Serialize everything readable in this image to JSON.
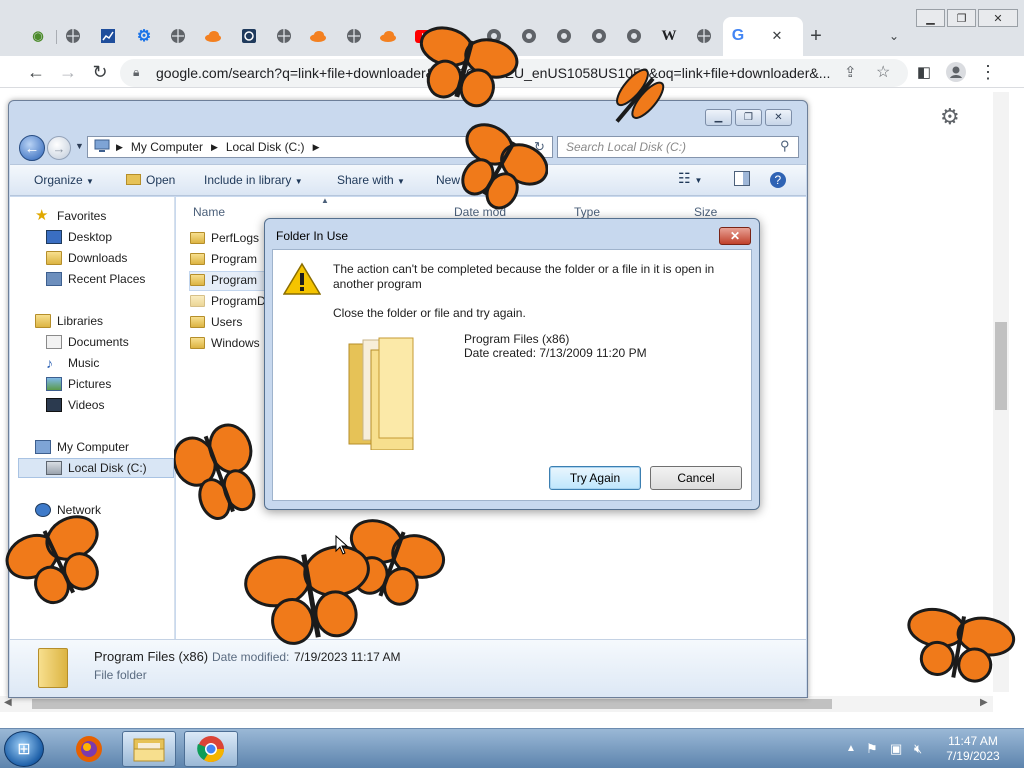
{
  "browser": {
    "url": "google.com/search?q=link+file+downloader&rlz=1C1GCEU_enUS1058US1058&oq=link+file+downloader&...",
    "tab_icons": [
      "frog-icon",
      "globe-icon",
      "chart-icon",
      "gear-icon",
      "globe-icon",
      "cloudflare-icon",
      "camera-icon",
      "globe-icon",
      "cloudflare-icon",
      "globe-icon",
      "cloudflare-icon",
      "youtube-icon",
      "chrome-icon",
      "chrome-icon",
      "chrome-icon",
      "chrome-icon",
      "chrome-icon",
      "wikipedia-icon",
      "globe-icon",
      "google-icon"
    ],
    "wiki_letter": "W",
    "google_letter": "G",
    "new_tab": "+",
    "close_tab": "✕"
  },
  "explorer": {
    "breadcrumb": [
      "My Computer",
      "Local Disk (C:)"
    ],
    "search_placeholder": "Search Local Disk (C:)",
    "toolbar": {
      "organize": "Organize",
      "open": "Open",
      "include_in_library": "Include in library",
      "share_with": "Share with",
      "new_folder": "New folder"
    },
    "nav": {
      "favorites": "Favorites",
      "desktop": "Desktop",
      "downloads": "Downloads",
      "recent_places": "Recent Places",
      "libraries": "Libraries",
      "documents": "Documents",
      "music": "Music",
      "pictures": "Pictures",
      "videos": "Videos",
      "my_computer": "My Computer",
      "local_disk": "Local Disk (C:)",
      "network": "Network"
    },
    "columns": {
      "name": "Name",
      "date_modified": "Date mod",
      "type": "Type",
      "size": "Size"
    },
    "files": [
      "PerfLogs",
      "Program",
      "Program",
      "ProgramD",
      "Users",
      "Windows"
    ],
    "details": {
      "name": "Program Files (x86)",
      "date_label": "Date modified:",
      "date_value": "7/19/2023 11:17 AM",
      "type": "File folder"
    }
  },
  "dialog": {
    "title": "Folder In Use",
    "message": "The action can't be completed because the folder or a file in it is open in another program",
    "instruction": "Close the folder or file and try again.",
    "item_name": "Program Files (x86)",
    "item_date": "Date created: 7/13/2009 11:20 PM",
    "try_again": "Try Again",
    "cancel": "Cancel",
    "close": "✕"
  },
  "taskbar": {
    "time": "11:47 AM",
    "date": "7/19/2023"
  },
  "colors": {
    "butterfly": "#f07a1a",
    "butterfly_dark": "#1b1b1b",
    "dialog_frame": "#c7d8ee"
  }
}
